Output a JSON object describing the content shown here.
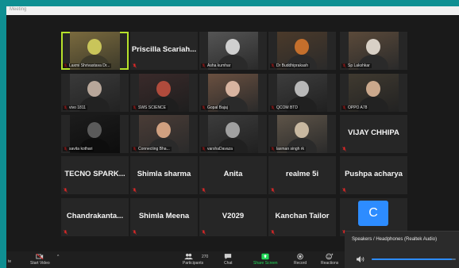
{
  "window": {
    "title": "Meeting"
  },
  "participants": [
    {
      "kind": "video",
      "caption": "Laxmi Shrivastava Dr...",
      "active": true,
      "palette": [
        "#7a6a3e",
        "#c9c55a",
        "#3d3a2a"
      ]
    },
    {
      "kind": "name",
      "name": "Priscilla Scariah..."
    },
    {
      "kind": "video",
      "caption": "Asha kumhar",
      "palette": [
        "#555",
        "#cfcfcf",
        "#2a2a2a"
      ]
    },
    {
      "kind": "video",
      "caption": "Dr Buddhiprakash",
      "palette": [
        "#4b3a2a",
        "#c46f2c",
        "#2a2a2a"
      ]
    },
    {
      "kind": "video",
      "caption": "Sp Lakshkar",
      "palette": [
        "#5b4a3a",
        "#d8d0c6",
        "#2a2a2a"
      ]
    },
    {
      "kind": "video",
      "caption": "vivo 1811",
      "palette": [
        "#3a3a3a",
        "#b8a79a",
        "#222"
      ]
    },
    {
      "kind": "video",
      "caption": "SWS SCIENCE",
      "palette": [
        "#3a2a2a",
        "#b04b3c",
        "#1e1e1e"
      ]
    },
    {
      "kind": "video",
      "caption": "Gopal Bajaj",
      "palette": [
        "#6a5040",
        "#d8b4a0",
        "#2a2a2a"
      ]
    },
    {
      "kind": "video",
      "caption": "QCOM BTD",
      "palette": [
        "#3d3d3d",
        "#b8b8b8",
        "#202020"
      ]
    },
    {
      "kind": "video",
      "caption": "OPPO A78",
      "palette": [
        "#403a30",
        "#caa88c",
        "#222"
      ]
    },
    {
      "kind": "video",
      "caption": "savita kothari",
      "palette": [
        "#1c1c1c",
        "#5a5a5a",
        "#0d0d0d"
      ]
    },
    {
      "kind": "video",
      "caption": "Connecting Bha...",
      "palette": [
        "#4a3c36",
        "#d0a080",
        "#2a2a2a"
      ]
    },
    {
      "kind": "video",
      "caption": "varshaDavaza",
      "palette": [
        "#3c3c3c",
        "#a0a0a0",
        "#202020"
      ]
    },
    {
      "kind": "video",
      "caption": "laxman singh rk",
      "palette": [
        "#5e5448",
        "#c8b8a0",
        "#2a2a2a"
      ]
    },
    {
      "kind": "name",
      "name": "VIJAY CHHIPA"
    },
    {
      "kind": "name",
      "name": "TECNO SPARK..."
    },
    {
      "kind": "name",
      "name": "Shimla sharma"
    },
    {
      "kind": "name",
      "name": "Anita"
    },
    {
      "kind": "name",
      "name": "realme 5i"
    },
    {
      "kind": "name",
      "name": "Pushpa acharya"
    },
    {
      "kind": "name",
      "name": "Chandrakanta..."
    },
    {
      "kind": "name",
      "name": "Shimla Meena"
    },
    {
      "kind": "name",
      "name": "V2029"
    },
    {
      "kind": "name",
      "name": "Kanchan Tailor"
    },
    {
      "kind": "avatar",
      "initial": "C"
    }
  ],
  "toolbar": {
    "left_partial": "te",
    "start_video": "Start Video",
    "participants_label": "Participants",
    "participants_count": "270",
    "chat": "Chat",
    "share_screen": "Share Screen",
    "record": "Record",
    "reactions": "Reactions"
  },
  "audio_popup": {
    "title": "Speakers / Headphones (Realtek Audio)",
    "volume": 0.95
  },
  "colors": {
    "share_green": "#23d959",
    "active_outline": "#b6e22b",
    "mic_muted": "#e02828",
    "avatar_blue": "#2d8cff"
  }
}
